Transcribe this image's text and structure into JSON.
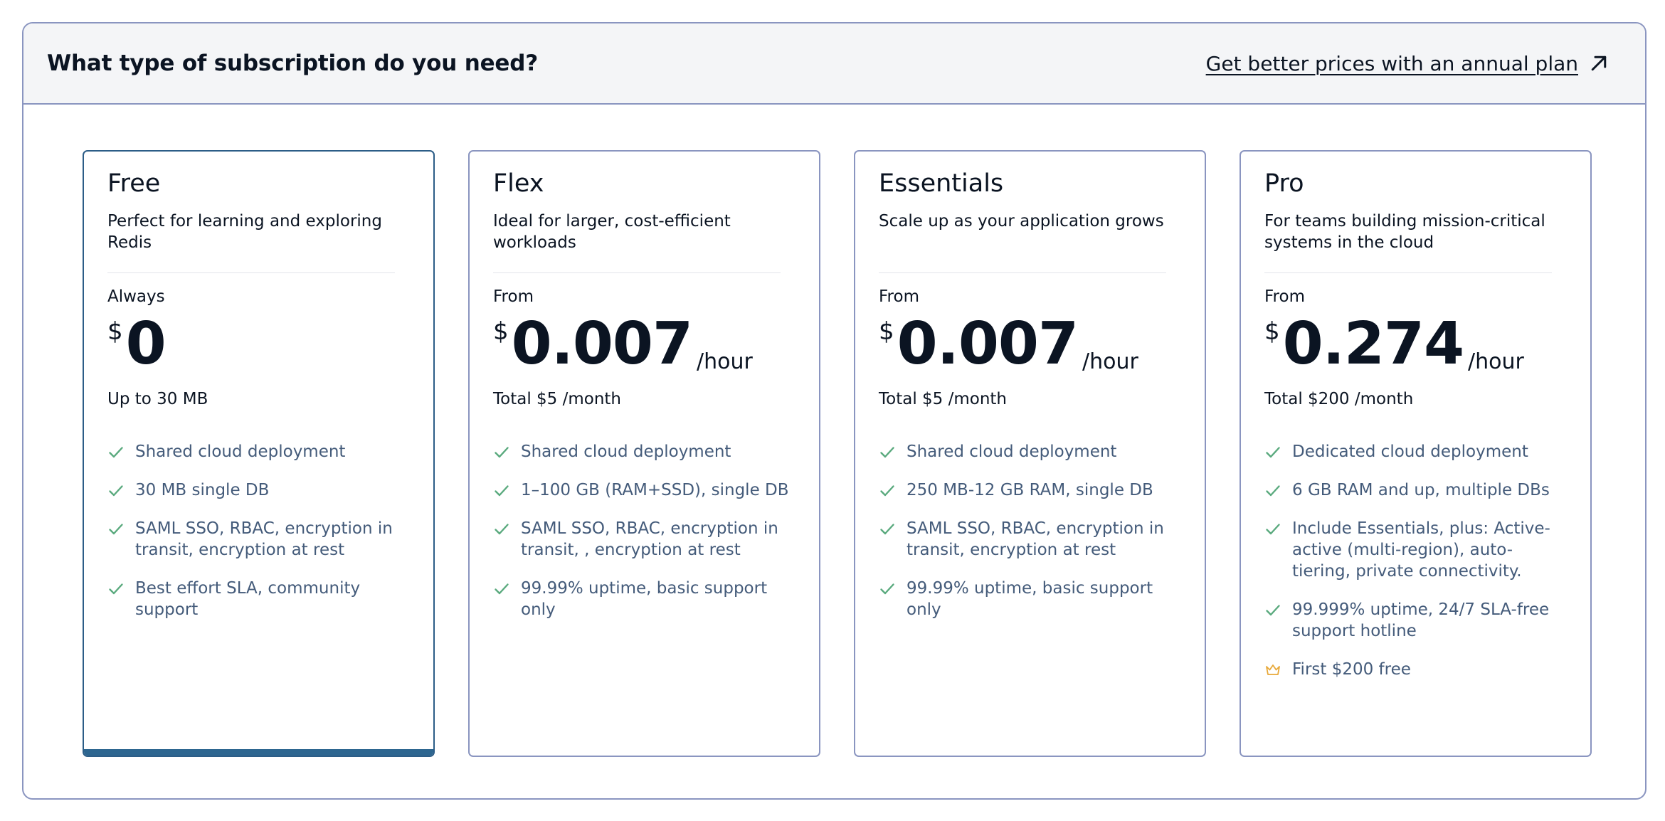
{
  "header": {
    "title": "What type of subscription do you need?",
    "annual_link": "Get better prices with an annual plan"
  },
  "colors": {
    "border": "#8a95c0",
    "selected_border": "#2c5d87",
    "selected_bar": "#2d6690",
    "check": "#5aaa7e",
    "crown": "#e8a838",
    "feature_text": "#445b7a"
  },
  "plans": [
    {
      "name": "Free",
      "description": "Perfect for learning and exploring Redis",
      "price_prefix": "Always",
      "currency": "$",
      "amount": "0",
      "unit": "",
      "total": "Up to 30 MB",
      "selected": true,
      "features": [
        {
          "icon": "check-icon",
          "text": "Shared cloud deployment"
        },
        {
          "icon": "check-icon",
          "text": "30 MB single DB"
        },
        {
          "icon": "check-icon",
          "text": "SAML SSO, RBAC, encryption in transit, encryption at rest"
        },
        {
          "icon": "check-icon",
          "text": "Best effort SLA, community support"
        }
      ]
    },
    {
      "name": "Flex",
      "description": "Ideal for larger, cost-efficient workloads",
      "price_prefix": "From",
      "currency": "$",
      "amount": "0.007",
      "unit": "/hour",
      "total": "Total $5 /month",
      "selected": false,
      "features": [
        {
          "icon": "check-icon",
          "text": "Shared cloud deployment"
        },
        {
          "icon": "check-icon",
          "text": "1–100 GB (RAM+SSD), single DB"
        },
        {
          "icon": "check-icon",
          "text": "SAML SSO, RBAC, encryption in transit, , encryption at rest"
        },
        {
          "icon": "check-icon",
          "text": "99.99% uptime, basic support only"
        }
      ]
    },
    {
      "name": "Essentials",
      "description": "Scale up as your application grows",
      "price_prefix": "From",
      "currency": "$",
      "amount": "0.007",
      "unit": "/hour",
      "total": "Total $5 /month",
      "selected": false,
      "features": [
        {
          "icon": "check-icon",
          "text": "Shared cloud deployment"
        },
        {
          "icon": "check-icon",
          "text": "250 MB-12 GB RAM, single DB"
        },
        {
          "icon": "check-icon",
          "text": "SAML SSO, RBAC, encryption in transit, encryption at rest"
        },
        {
          "icon": "check-icon",
          "text": "99.99% uptime, basic support only"
        }
      ]
    },
    {
      "name": "Pro",
      "description": "For teams building mission-critical systems in the cloud",
      "price_prefix": "From",
      "currency": "$",
      "amount": "0.274",
      "unit": "/hour",
      "total": "Total $200 /month",
      "selected": false,
      "features": [
        {
          "icon": "check-icon",
          "text": "Dedicated cloud deployment"
        },
        {
          "icon": "check-icon",
          "text": "6 GB RAM and up, multiple DBs"
        },
        {
          "icon": "check-icon",
          "text": "Include Essentials, plus: Active-active (multi-region), auto-tiering, private connectivity."
        },
        {
          "icon": "check-icon",
          "text": "99.999% uptime, 24/7 SLA-free support hotline"
        },
        {
          "icon": "crown-icon",
          "text": "First $200 free"
        }
      ]
    }
  ]
}
